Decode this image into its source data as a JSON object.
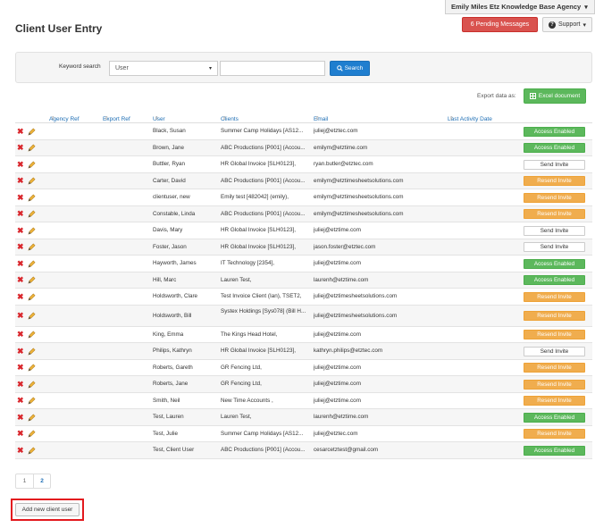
{
  "header": {
    "user_menu_label": "Emily Miles Etz Knowledge Base Agency",
    "page_title": "Client User Entry",
    "pending_messages_label": "6 Pending Messages",
    "support_label": "Support"
  },
  "search": {
    "keyword_label": "Keyword search",
    "field_selected": "User",
    "keyword_value": "",
    "search_label": "Search"
  },
  "export": {
    "label": "Export data as:",
    "excel_label": "Excel document"
  },
  "table": {
    "columns": [
      "Agency Ref",
      "Export Ref",
      "User",
      "Clients",
      "Email",
      "Last Activity Date"
    ],
    "rows": [
      {
        "user": "Black, Susan",
        "client": "Summer Camp Holidays [AS12...",
        "email": "juliej@etztec.com",
        "status": "Access Enabled",
        "state": "enabled"
      },
      {
        "user": "Brown, Jane",
        "client": "ABC Productions [P001] (Accou...",
        "email": "emilym@etztime.com",
        "status": "Access Enabled",
        "state": "enabled"
      },
      {
        "user": "Buttler, Ryan",
        "client": "HR Global Invoice [SLH0123],",
        "email": "ryan.butler@etztec.com",
        "status": "Send Invite",
        "state": "send"
      },
      {
        "user": "Carter, David",
        "client": "ABC Productions [P001] (Accou...",
        "email": "emilym@etztimesheetsolutions.com",
        "status": "Resend Invite",
        "state": "resend"
      },
      {
        "user": "clientuser, new",
        "client": "Emily test [482042] (emily),",
        "email": "emilym@etztimesheetsolutions.com",
        "status": "Resend Invite",
        "state": "resend"
      },
      {
        "user": "Constable, Linda",
        "client": "ABC Productions [P001] (Accou...",
        "email": "emilym@etztimesheetsolutions.com",
        "status": "Resend Invite",
        "state": "resend"
      },
      {
        "user": "Davis, Mary",
        "client": "HR Global Invoice [SLH0123],",
        "email": "juliej@etztime.com",
        "status": "Send Invite",
        "state": "send"
      },
      {
        "user": "Foster, Jason",
        "client": "HR Global Invoice [SLH0123],",
        "email": "jason.foster@etztec.com",
        "status": "Send Invite",
        "state": "send"
      },
      {
        "user": "Hayworth, James",
        "client": "IT Technology [2354],",
        "email": "juliej@etztime.com",
        "status": "Access Enabled",
        "state": "enabled"
      },
      {
        "user": "Hill, Marc",
        "client": "Lauren Test,",
        "email": "laurenh@etztime.com",
        "status": "Access Enabled",
        "state": "enabled"
      },
      {
        "user": "Holdsworth, Clare",
        "client": "Test Invoice Client (Ian), TSET2,",
        "email": "juliej@etztimesheetsolutions.com",
        "status": "Resend Invite",
        "state": "resend"
      },
      {
        "user": "Holdsworth, Bill",
        "client": "Systex Holdings [Sys078] (Bill H...",
        "email": "juliej@etztimesheetsolutions.com",
        "status": "Resend Invite",
        "state": "resend",
        "tall": true
      },
      {
        "user": "King, Emma",
        "client": "The Kings Head Hotel,",
        "email": "juliej@etztime.com",
        "status": "Resend Invite",
        "state": "resend"
      },
      {
        "user": "Philips, Kathryn",
        "client": "HR Global Invoice [SLH0123],",
        "email": "kathryn.philips@etztec.com",
        "status": "Send Invite",
        "state": "send"
      },
      {
        "user": "Roberts, Gareth",
        "client": "GR Fencing Ltd,",
        "email": "juliej@etztime.com",
        "status": "Resend Invite",
        "state": "resend"
      },
      {
        "user": "Roberts, Jane",
        "client": "GR Fencing Ltd,",
        "email": "juliej@etztime.com",
        "status": "Resend Invite",
        "state": "resend"
      },
      {
        "user": "Smith, Neil",
        "client": "New Time Accounts ,",
        "email": "juliej@etztime.com",
        "status": "Resend Invite",
        "state": "resend"
      },
      {
        "user": "Test, Lauren",
        "client": "Lauren Test,",
        "email": "laurenh@etztime.com",
        "status": "Access Enabled",
        "state": "enabled"
      },
      {
        "user": "Test, Julie",
        "client": "Summer Camp Holidays [AS12...",
        "email": "juliej@etztec.com",
        "status": "Resend Invite",
        "state": "resend"
      },
      {
        "user": "Test, Client User",
        "client": "ABC Productions [P001] (Accou...",
        "email": "cesarcetztest@gmail.com",
        "status": "Access Enabled",
        "state": "enabled"
      }
    ]
  },
  "pagination": {
    "pages": [
      "1",
      "2"
    ],
    "active": "2"
  },
  "add_button_label": "Add new client user",
  "colors": {
    "enabled": "#5cb85c",
    "resend": "#f0ad4e",
    "danger": "#d9534f",
    "primary": "#1f7ecf"
  }
}
